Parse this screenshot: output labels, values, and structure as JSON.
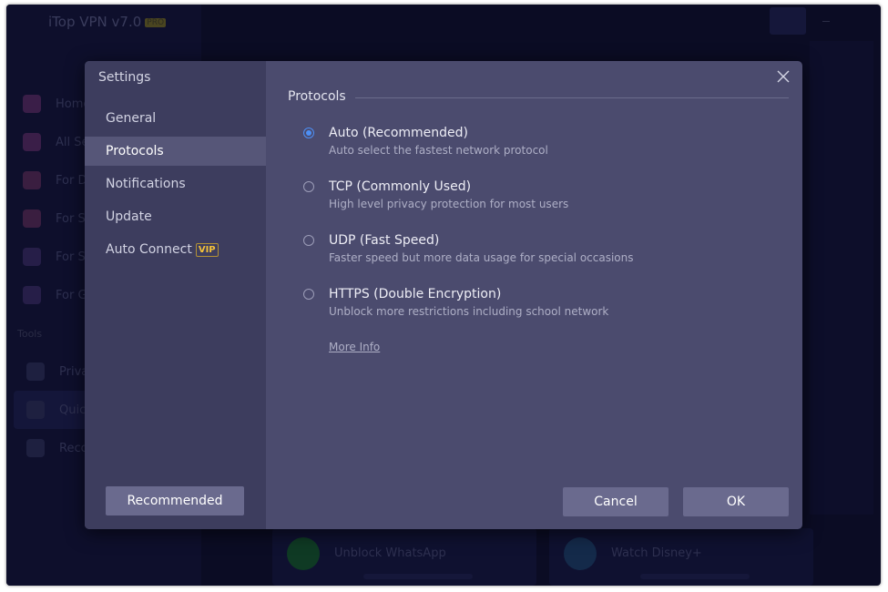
{
  "background": {
    "app_title": "iTop VPN v7.0",
    "pro_badge": "PRO",
    "nav_items": [
      "Home",
      "All Se",
      "For D",
      "For S",
      "For S",
      "For G"
    ],
    "tools_label": "Tools",
    "tool_items": [
      "Priva",
      "Quic",
      "Reco"
    ],
    "cards": [
      "Unblock WhatsApp",
      "Watch Disney+"
    ]
  },
  "dialog": {
    "title": "Settings",
    "nav": [
      {
        "label": "General"
      },
      {
        "label": "Protocols"
      },
      {
        "label": "Notifications"
      },
      {
        "label": "Update"
      },
      {
        "label": "Auto Connect",
        "badge": "VIP"
      }
    ],
    "recommended_button": "Recommended",
    "section_title": "Protocols",
    "protocols": [
      {
        "label": "Auto (Recommended)",
        "description": "Auto select the fastest network protocol",
        "selected": true
      },
      {
        "label": "TCP (Commonly Used)",
        "description": "High level privacy protection for most users",
        "selected": false
      },
      {
        "label": "UDP (Fast Speed)",
        "description": "Faster speed but more data usage for special occasions",
        "selected": false
      },
      {
        "label": "HTTPS (Double Encryption)",
        "description": "Unblock more restrictions including school network",
        "selected": false
      }
    ],
    "more_info": "More Info",
    "cancel_button": "Cancel",
    "ok_button": "OK"
  },
  "colors": {
    "dialog_bg": "#4b4b6e",
    "sidebar_bg": "#3d3d5e",
    "active_nav_bg": "#565678",
    "button_bg": "#6a6a8e",
    "radio_accent": "#4d8ff5",
    "vip_color": "#f3c13a"
  },
  "icons": {
    "close": "close-icon",
    "radio_checked": "radio-checked-icon",
    "radio_unchecked": "radio-unchecked-icon"
  }
}
